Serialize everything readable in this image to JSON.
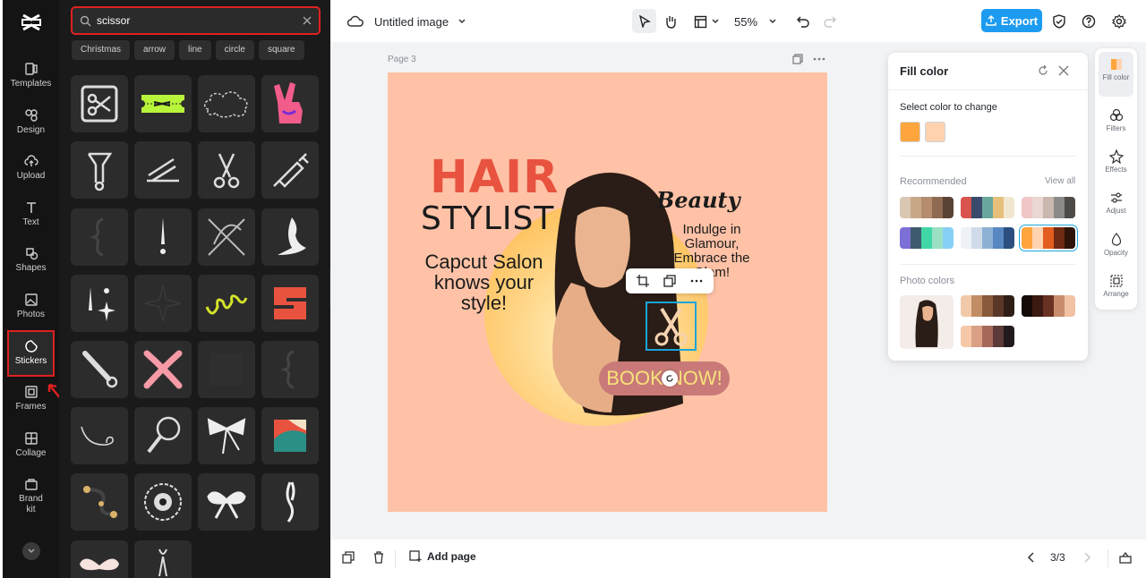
{
  "nav": {
    "items": [
      "Templates",
      "Design",
      "Upload",
      "Text",
      "Shapes",
      "Photos",
      "Stickers",
      "Frames",
      "Collage",
      "Brand kit"
    ],
    "active": "Stickers"
  },
  "search": {
    "value": "scissor"
  },
  "chips": [
    "Christmas",
    "arrow",
    "line",
    "circle",
    "square"
  ],
  "topbar": {
    "title": "Untitled image",
    "zoom": "55%",
    "export_label": "Export"
  },
  "canvas": {
    "page_label": "Page 3",
    "hair": "HAIR",
    "stylist": "STYLIST",
    "salon": "Capcut Salon knows your style!",
    "beauty": "Beauty",
    "indulge": "Indulge in Glamour, Embrace the Glam!",
    "book": "BOOK NOW!"
  },
  "bottombar": {
    "add_page": "Add page",
    "page_count": "3/3"
  },
  "fill_panel": {
    "title": "Fill color",
    "select_label": "Select color to change",
    "selected_colors": [
      "#ffa53d",
      "#ffd3b0"
    ],
    "recommended_label": "Recommended",
    "view_all": "View all",
    "recommended": [
      [
        "#d9c7b3",
        "#c9a888",
        "#b58c6d",
        "#8f6a52",
        "#5a4234"
      ],
      [
        "#d9544c",
        "#3a4a6b",
        "#6aa79d",
        "#e6c07a",
        "#f1e6cf"
      ],
      [
        "#f0c6c6",
        "#e8d7d2",
        "#c9b7b0",
        "#8c8a88",
        "#4d4a48"
      ],
      [
        "#7c6fd6",
        "#3d5b6e",
        "#41d6a6",
        "#9be0c4",
        "#87d0f5"
      ],
      [
        "#eef2f6",
        "#cfdbe8",
        "#8db1d4",
        "#5888c2",
        "#2c4f7f"
      ],
      [
        "#ffa53d",
        "#ffd3b0",
        "#e25d1e",
        "#6e2a12",
        "#2e1408"
      ]
    ],
    "photo_colors_label": "Photo colors",
    "photo_colors": [
      [
        "#f2c9a8",
        "#c08d65",
        "#8a5a3c",
        "#5a3828",
        "#2f1e17"
      ],
      [
        "#140a07",
        "#3a1a12",
        "#6a3222",
        "#c98d6e",
        "#f1c2a3"
      ],
      [
        "#f7c8a8",
        "#d9a084",
        "#a5695a",
        "#5c3b3a",
        "#221a1c"
      ]
    ]
  },
  "right_rail": [
    "Fill color",
    "Filters",
    "Effects",
    "Adjust",
    "Opacity",
    "Arrange"
  ]
}
